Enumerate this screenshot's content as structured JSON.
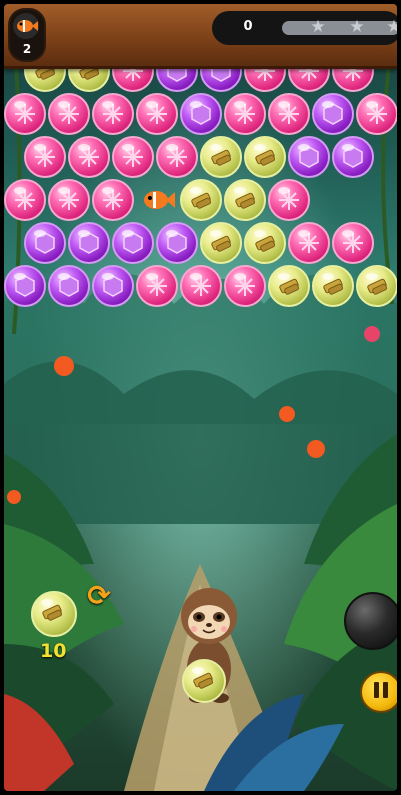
{
  "hud": {
    "fish_count": "2",
    "score": "0",
    "progress": 0.0,
    "stars": [
      "star-1",
      "star-2",
      "star-3"
    ]
  },
  "bubble_grid": [
    [
      "yellow",
      "yellow",
      "pink",
      "purple",
      "purple",
      "pink",
      "pink",
      "pink"
    ],
    [
      "pink",
      "pink",
      "pink",
      "pink",
      "purple",
      "pink",
      "pink",
      "purple",
      "pink"
    ],
    [
      "pink",
      "pink",
      "pink",
      "pink",
      "yellow",
      "yellow",
      "purple",
      "purple"
    ],
    [
      "pink",
      "pink",
      "pink",
      "fish",
      "yellow",
      "yellow",
      "pink"
    ],
    [
      "purple",
      "purple",
      "purple",
      "purple",
      "yellow",
      "yellow",
      "pink",
      "pink"
    ],
    [
      "purple",
      "purple",
      "purple",
      "pink",
      "pink",
      "pink",
      "yellow",
      "yellow",
      "yellow"
    ]
  ],
  "launcher": {
    "next_bubble_color": "yellow",
    "shots_remaining": "10",
    "loaded_bubble_color": "yellow"
  },
  "icons": {
    "swap": "swap-icon",
    "bomb": "bomb-icon",
    "pause": "pause-icon",
    "fish": "fish-icon"
  },
  "colors": {
    "pink": "#e0277f",
    "purple": "#8b1fc4",
    "yellow": "#b7c34d",
    "shots": "#f3e12f",
    "pause": "#f4b90c"
  }
}
